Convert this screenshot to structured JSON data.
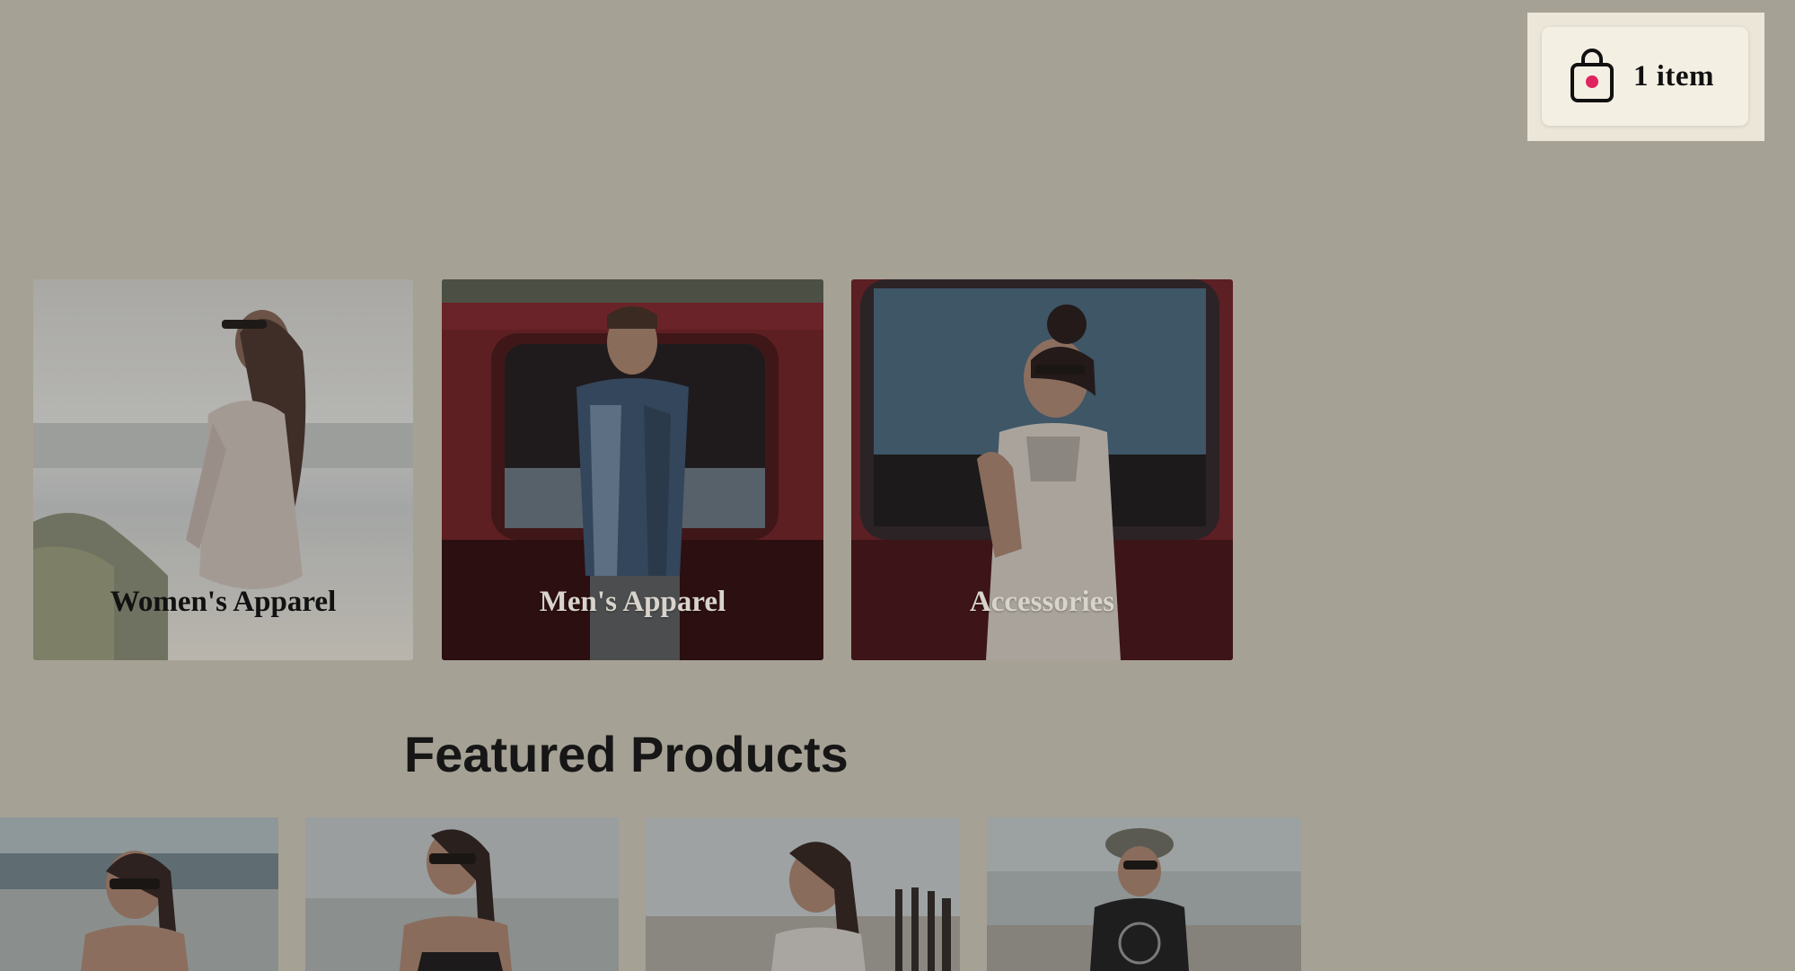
{
  "cart": {
    "label": "1 item",
    "badge_color": "#e0245e"
  },
  "categories": [
    {
      "label": "Women's Apparel"
    },
    {
      "label": "Men's Apparel"
    },
    {
      "label": "Accessories"
    }
  ],
  "featured": {
    "title": "Featured Products"
  },
  "colors": {
    "page_background": "#a6a195",
    "cart_panel": "#f4efe3"
  }
}
